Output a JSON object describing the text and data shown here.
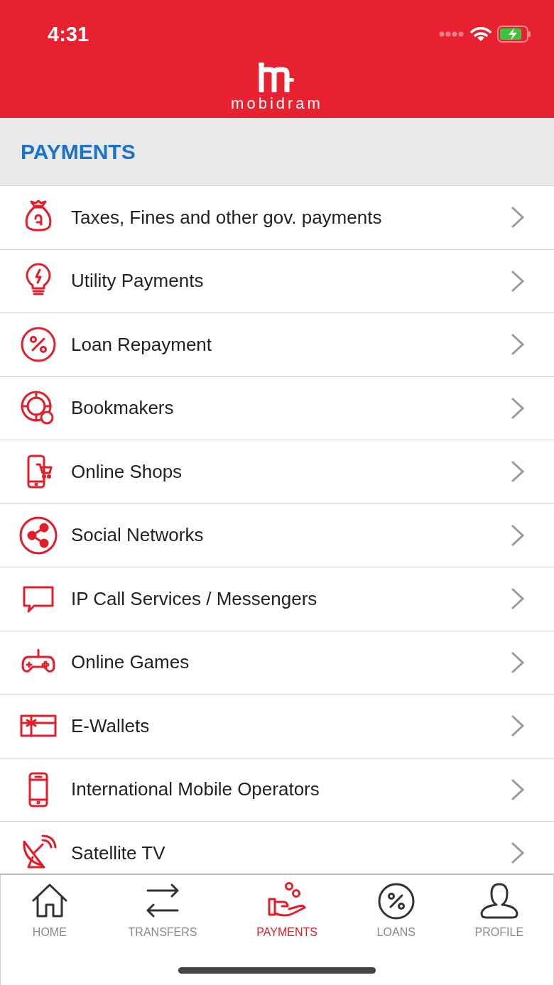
{
  "status_bar": {
    "time": "4:31"
  },
  "header": {
    "logo_text": "mobidram"
  },
  "section": {
    "title": "PAYMENTS"
  },
  "items": [
    {
      "label": "Taxes, Fines and other gov. payments"
    },
    {
      "label": "Utility Payments"
    },
    {
      "label": "Loan Repayment"
    },
    {
      "label": "Bookmakers"
    },
    {
      "label": "Online Shops"
    },
    {
      "label": "Social Networks"
    },
    {
      "label": "IP Call Services / Messengers"
    },
    {
      "label": "Online Games"
    },
    {
      "label": "E-Wallets"
    },
    {
      "label": "International Mobile Operators"
    },
    {
      "label": "Satellite TV"
    }
  ],
  "tabs": [
    {
      "label": "HOME",
      "selected": false
    },
    {
      "label": "TRANSFERS",
      "selected": false
    },
    {
      "label": "PAYMENTS",
      "selected": true
    },
    {
      "label": "LOANS",
      "selected": false
    },
    {
      "label": "PROFILE",
      "selected": false
    }
  ]
}
